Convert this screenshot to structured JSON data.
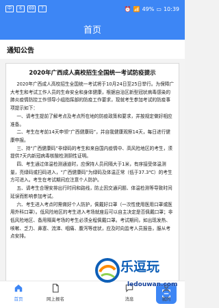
{
  "status": {
    "left_items": [
      "中",
      "6",
      "69",
      "?"
    ],
    "battery": "49%",
    "time": "10:39"
  },
  "header": {
    "title": "首页"
  },
  "section": {
    "title": "通知公告"
  },
  "notice": {
    "title": "2020年广西成人高校招生全国统一考试防疫提示",
    "intro": "2020年广西成人高校招生全国统一考试将于10月24日至25日举行。为保障广大考生和考试工作人员的生命安全和身体健康，根据自治区新型冠状病毒感染的肺炎疫情防控工作领导小组指挥部的防疫工作要求，现就考生参加考试的防疫事项提示如下：",
    "items": [
      "一、请考生提前了解考点及考点所在地的防疫政策和要求，并按规定做好相应准备。",
      "二、考生在考前14天申领“广西健康码”，并自我健康观察14天，每日进行健康申报。",
      "三、持“广西健康码”非绿码的考生和来自国内疫情中、高风险地区的考生，须提供7天内新冠病毒核酸检测阴性证明。",
      "四、考生通过体温检测通道时，应保持人员间隔大于1米，有序接受体温测量，亮绿码或扫码进入，“广西健康码”为绿码及体温正常（低于37.3℃）的考生方可进入。考生在考试期间应注意个人防护。",
      "五、请考生合理安排出行时间和路线，防止因交通问题、体温检测等导致时间延误而影响参加考试。",
      "六、考生进入考点时需做好个人防护，佩戴好口罩（一次性使用医用口罩或医用外科口罩）。低风险地区的考生进入考场就座后可以自主决定是否佩戴口罩；非低风险地区、备用隔离考场的考生必须全程佩戴口罩。考试期间，如出现发热、咳嗽、乏力、鼻塞、流涕、咽痛、腹泻等症状，应及时向监考人员报告，服从考点安排。"
    ]
  },
  "bottom_nav": {
    "items": [
      {
        "label": "首页",
        "icon": "home-icon",
        "active": true
      },
      {
        "label": "网上报名",
        "icon": "doc-icon",
        "active": false
      },
      {
        "label": "",
        "icon": "scan-icon",
        "active": false
      },
      {
        "label": "消息",
        "icon": "message-icon",
        "active": false
      },
      {
        "label": "我的",
        "icon": "user-icon",
        "active": false
      }
    ]
  },
  "watermark": {
    "brand": "乐逗玩",
    "site": "ledouwan.com"
  },
  "colors": {
    "primary": "#3d86f5",
    "watermark_blue": "#0e5fb7"
  }
}
